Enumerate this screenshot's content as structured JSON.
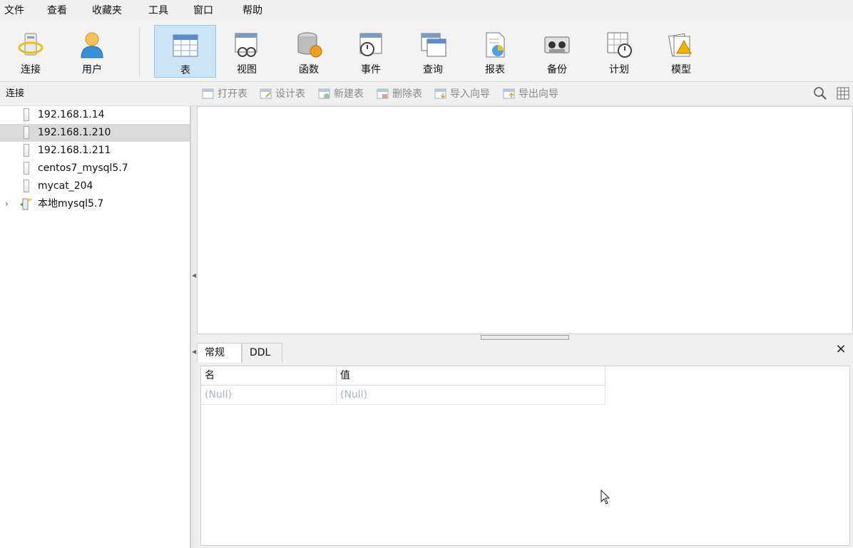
{
  "menu": [
    "文件",
    "查看",
    "收藏夹",
    "工具",
    "窗口",
    "帮助"
  ],
  "ribbon": [
    {
      "label": "连接",
      "icon": "connection-icon",
      "active": false
    },
    {
      "label": "用户",
      "icon": "user-icon",
      "active": false
    },
    {
      "label": "表",
      "icon": "table-icon",
      "active": true
    },
    {
      "label": "视图",
      "icon": "view-icon",
      "active": false
    },
    {
      "label": "函数",
      "icon": "function-icon",
      "active": false
    },
    {
      "label": "事件",
      "icon": "event-icon",
      "active": false
    },
    {
      "label": "查询",
      "icon": "query-icon",
      "active": false
    },
    {
      "label": "报表",
      "icon": "report-icon",
      "active": false
    },
    {
      "label": "备份",
      "icon": "backup-icon",
      "active": false
    },
    {
      "label": "计划",
      "icon": "schedule-icon",
      "active": false
    },
    {
      "label": "模型",
      "icon": "model-icon",
      "active": false
    }
  ],
  "connections_header": "连接",
  "object_toolbar": [
    "打开表",
    "设计表",
    "新建表",
    "删除表",
    "导入向导",
    "导出向导"
  ],
  "tree": [
    {
      "label": "192.168.1.14",
      "selected": false
    },
    {
      "label": "192.168.1.210",
      "selected": true
    },
    {
      "label": "192.168.1.211",
      "selected": false
    },
    {
      "label": "centos7_mysql5.7",
      "selected": false
    },
    {
      "label": "mycat_204",
      "selected": false
    },
    {
      "label": "本地mysql5.7",
      "selected": false,
      "expandable": true
    }
  ],
  "info_tabs": [
    "常规",
    "DDL"
  ],
  "info_close": "×",
  "info_grid": {
    "headers": [
      "名",
      "值"
    ],
    "row": [
      "(Null)",
      "(Null)"
    ]
  },
  "colors": {
    "accent": "#cce4f7",
    "selected_row": "#dadada",
    "null_text": "#a8b4c0"
  }
}
